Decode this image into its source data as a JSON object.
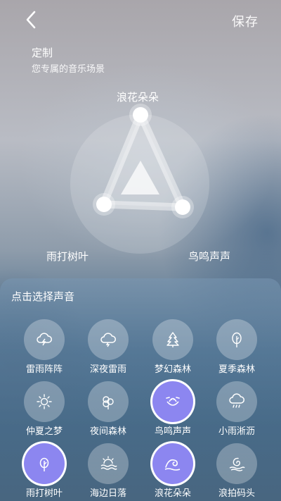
{
  "header": {
    "save_label": "保存"
  },
  "intro": {
    "title": "定制",
    "subtitle": "您专属的音乐场景"
  },
  "mixer": {
    "top_label": "浪花朵朵",
    "left_label": "雨打树叶",
    "right_label": "鸟鸣声声"
  },
  "panel": {
    "title": "点击选择声音",
    "sounds": [
      {
        "label": "雷雨阵阵",
        "icon": "thunderstorm-cloud-icon",
        "selected": false
      },
      {
        "label": "深夜雷雨",
        "icon": "night-thunder-cloud-icon",
        "selected": false
      },
      {
        "label": "梦幻森林",
        "icon": "pine-tree-icon",
        "selected": false
      },
      {
        "label": "夏季森林",
        "icon": "leafy-tree-icon",
        "selected": false
      },
      {
        "label": "仲夏之梦",
        "icon": "sun-icon",
        "selected": false
      },
      {
        "label": "夜间森林",
        "icon": "night-trees-icon",
        "selected": false
      },
      {
        "label": "鸟鸣声声",
        "icon": "bird-nest-icon",
        "selected": true
      },
      {
        "label": "小雨淅沥",
        "icon": "rain-cloud-icon",
        "selected": false
      },
      {
        "label": "雨打树叶",
        "icon": "rain-on-leaf-icon",
        "selected": true
      },
      {
        "label": "海边日落",
        "icon": "sunset-sea-icon",
        "selected": false
      },
      {
        "label": "浪花朵朵",
        "icon": "wave-icon",
        "selected": true
      },
      {
        "label": "浪拍码头",
        "icon": "spiral-wave-icon",
        "selected": false
      }
    ]
  },
  "colors": {
    "selected_bubble": "#8c86f0",
    "panel_bg": "#5f87a8"
  }
}
